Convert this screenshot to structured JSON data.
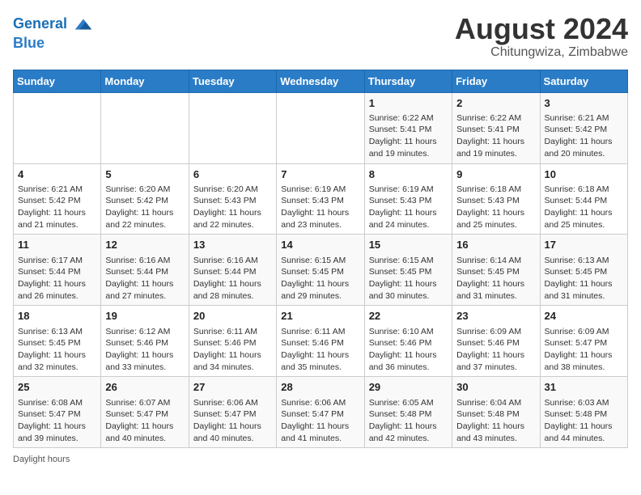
{
  "header": {
    "logo_line1": "General",
    "logo_line2": "Blue",
    "month_year": "August 2024",
    "location": "Chitungwiza, Zimbabwe"
  },
  "days_of_week": [
    "Sunday",
    "Monday",
    "Tuesday",
    "Wednesday",
    "Thursday",
    "Friday",
    "Saturday"
  ],
  "weeks": [
    [
      {
        "day": "",
        "info": ""
      },
      {
        "day": "",
        "info": ""
      },
      {
        "day": "",
        "info": ""
      },
      {
        "day": "",
        "info": ""
      },
      {
        "day": "1",
        "info": "Sunrise: 6:22 AM\nSunset: 5:41 PM\nDaylight: 11 hours and 19 minutes."
      },
      {
        "day": "2",
        "info": "Sunrise: 6:22 AM\nSunset: 5:41 PM\nDaylight: 11 hours and 19 minutes."
      },
      {
        "day": "3",
        "info": "Sunrise: 6:21 AM\nSunset: 5:42 PM\nDaylight: 11 hours and 20 minutes."
      }
    ],
    [
      {
        "day": "4",
        "info": "Sunrise: 6:21 AM\nSunset: 5:42 PM\nDaylight: 11 hours and 21 minutes."
      },
      {
        "day": "5",
        "info": "Sunrise: 6:20 AM\nSunset: 5:42 PM\nDaylight: 11 hours and 22 minutes."
      },
      {
        "day": "6",
        "info": "Sunrise: 6:20 AM\nSunset: 5:43 PM\nDaylight: 11 hours and 22 minutes."
      },
      {
        "day": "7",
        "info": "Sunrise: 6:19 AM\nSunset: 5:43 PM\nDaylight: 11 hours and 23 minutes."
      },
      {
        "day": "8",
        "info": "Sunrise: 6:19 AM\nSunset: 5:43 PM\nDaylight: 11 hours and 24 minutes."
      },
      {
        "day": "9",
        "info": "Sunrise: 6:18 AM\nSunset: 5:43 PM\nDaylight: 11 hours and 25 minutes."
      },
      {
        "day": "10",
        "info": "Sunrise: 6:18 AM\nSunset: 5:44 PM\nDaylight: 11 hours and 25 minutes."
      }
    ],
    [
      {
        "day": "11",
        "info": "Sunrise: 6:17 AM\nSunset: 5:44 PM\nDaylight: 11 hours and 26 minutes."
      },
      {
        "day": "12",
        "info": "Sunrise: 6:16 AM\nSunset: 5:44 PM\nDaylight: 11 hours and 27 minutes."
      },
      {
        "day": "13",
        "info": "Sunrise: 6:16 AM\nSunset: 5:44 PM\nDaylight: 11 hours and 28 minutes."
      },
      {
        "day": "14",
        "info": "Sunrise: 6:15 AM\nSunset: 5:45 PM\nDaylight: 11 hours and 29 minutes."
      },
      {
        "day": "15",
        "info": "Sunrise: 6:15 AM\nSunset: 5:45 PM\nDaylight: 11 hours and 30 minutes."
      },
      {
        "day": "16",
        "info": "Sunrise: 6:14 AM\nSunset: 5:45 PM\nDaylight: 11 hours and 31 minutes."
      },
      {
        "day": "17",
        "info": "Sunrise: 6:13 AM\nSunset: 5:45 PM\nDaylight: 11 hours and 31 minutes."
      }
    ],
    [
      {
        "day": "18",
        "info": "Sunrise: 6:13 AM\nSunset: 5:45 PM\nDaylight: 11 hours and 32 minutes."
      },
      {
        "day": "19",
        "info": "Sunrise: 6:12 AM\nSunset: 5:46 PM\nDaylight: 11 hours and 33 minutes."
      },
      {
        "day": "20",
        "info": "Sunrise: 6:11 AM\nSunset: 5:46 PM\nDaylight: 11 hours and 34 minutes."
      },
      {
        "day": "21",
        "info": "Sunrise: 6:11 AM\nSunset: 5:46 PM\nDaylight: 11 hours and 35 minutes."
      },
      {
        "day": "22",
        "info": "Sunrise: 6:10 AM\nSunset: 5:46 PM\nDaylight: 11 hours and 36 minutes."
      },
      {
        "day": "23",
        "info": "Sunrise: 6:09 AM\nSunset: 5:46 PM\nDaylight: 11 hours and 37 minutes."
      },
      {
        "day": "24",
        "info": "Sunrise: 6:09 AM\nSunset: 5:47 PM\nDaylight: 11 hours and 38 minutes."
      }
    ],
    [
      {
        "day": "25",
        "info": "Sunrise: 6:08 AM\nSunset: 5:47 PM\nDaylight: 11 hours and 39 minutes."
      },
      {
        "day": "26",
        "info": "Sunrise: 6:07 AM\nSunset: 5:47 PM\nDaylight: 11 hours and 40 minutes."
      },
      {
        "day": "27",
        "info": "Sunrise: 6:06 AM\nSunset: 5:47 PM\nDaylight: 11 hours and 40 minutes."
      },
      {
        "day": "28",
        "info": "Sunrise: 6:06 AM\nSunset: 5:47 PM\nDaylight: 11 hours and 41 minutes."
      },
      {
        "day": "29",
        "info": "Sunrise: 6:05 AM\nSunset: 5:48 PM\nDaylight: 11 hours and 42 minutes."
      },
      {
        "day": "30",
        "info": "Sunrise: 6:04 AM\nSunset: 5:48 PM\nDaylight: 11 hours and 43 minutes."
      },
      {
        "day": "31",
        "info": "Sunrise: 6:03 AM\nSunset: 5:48 PM\nDaylight: 11 hours and 44 minutes."
      }
    ]
  ],
  "footer": {
    "text": "Daylight hours"
  }
}
